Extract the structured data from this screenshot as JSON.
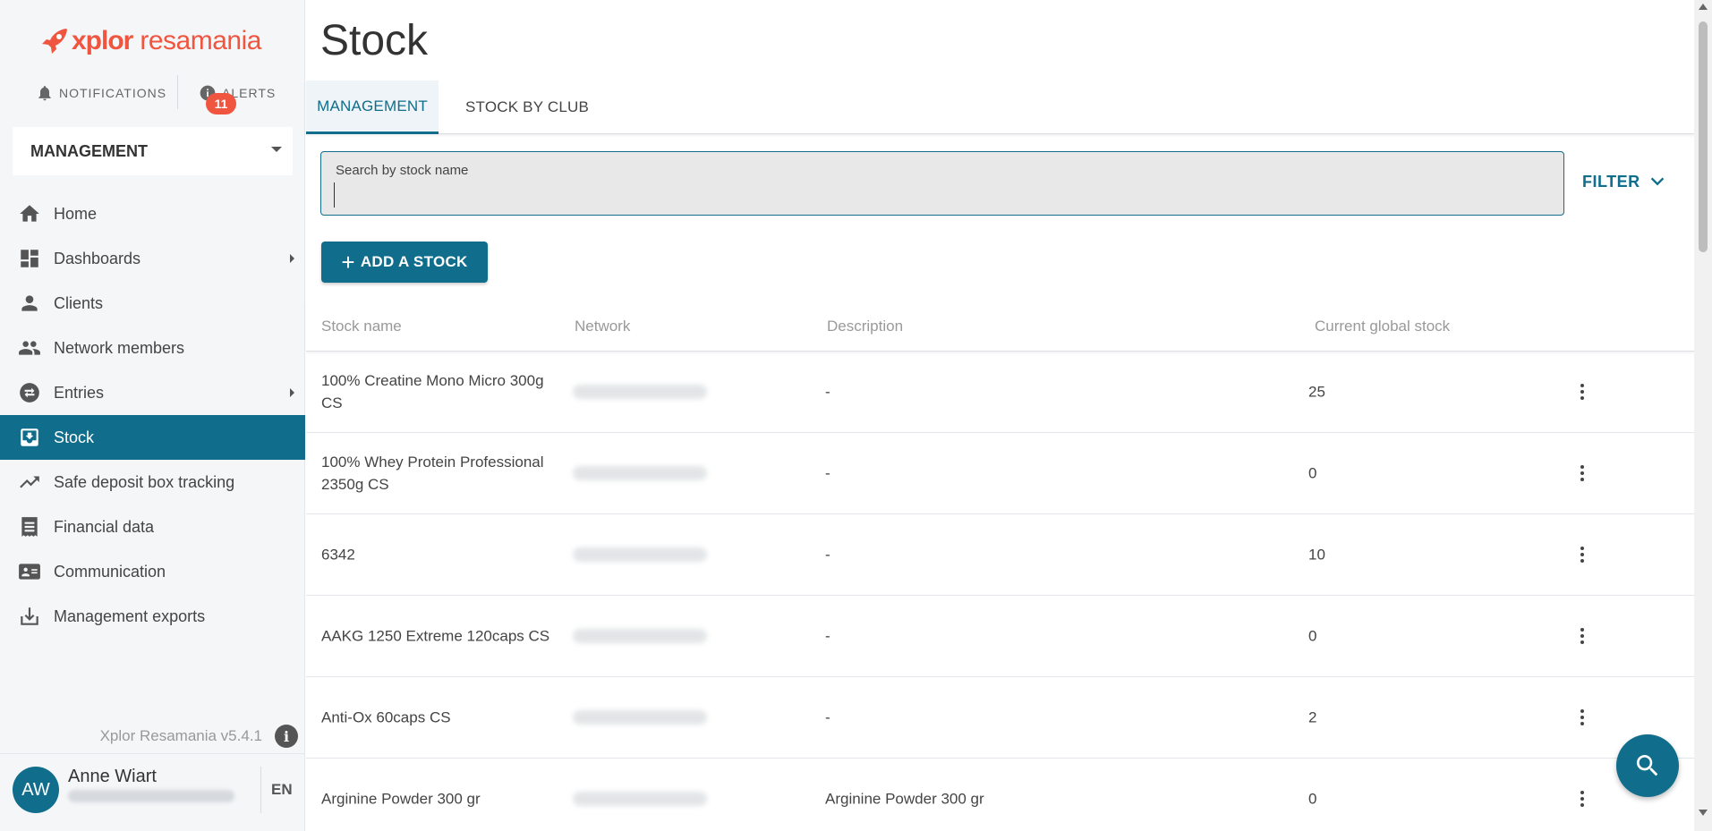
{
  "brand": {
    "name_part1": "xplor",
    "name_part2": "resamania",
    "color": "#f0553f"
  },
  "top_buttons": {
    "notifications": "NOTIFICATIONS",
    "alerts": "ALERTS",
    "alerts_count": "11"
  },
  "context_select": {
    "value": "MANAGEMENT"
  },
  "sidebar": {
    "items": [
      {
        "label": "Home",
        "icon": "home-icon"
      },
      {
        "label": "Dashboards",
        "icon": "dashboard-icon"
      },
      {
        "label": "Clients",
        "icon": "person-icon"
      },
      {
        "label": "Network members",
        "icon": "people-icon"
      },
      {
        "label": "Entries",
        "icon": "swap-icon"
      },
      {
        "label": "Stock",
        "icon": "stock-icon"
      },
      {
        "label": "Safe deposit box tracking",
        "icon": "trending-up-icon"
      },
      {
        "label": "Financial data",
        "icon": "receipt-icon"
      },
      {
        "label": "Communication",
        "icon": "contact-card-icon"
      },
      {
        "label": "Management exports",
        "icon": "download-icon"
      }
    ],
    "version": "Xplor Resamania v5.4.1"
  },
  "user": {
    "initials": "AW",
    "name": "Anne Wiart",
    "language": "EN"
  },
  "main": {
    "title": "Stock",
    "tabs": [
      {
        "label": "MANAGEMENT"
      },
      {
        "label": "STOCK BY CLUB"
      }
    ],
    "search": {
      "label": "Search by stock name",
      "value": ""
    },
    "filter_label": "FILTER",
    "add_button": "ADD A STOCK",
    "table": {
      "headers": [
        "Stock name",
        "Network",
        "Description",
        "Current global stock"
      ],
      "rows": [
        {
          "name": "100% Creatine Mono Micro 300g CS",
          "description": "-",
          "stock": "25"
        },
        {
          "name": "100% Whey Protein Professional 2350g CS",
          "description": "-",
          "stock": "0"
        },
        {
          "name": "6342",
          "description": "-",
          "stock": "10"
        },
        {
          "name": "AAKG 1250 Extreme 120caps CS",
          "description": "-",
          "stock": "0"
        },
        {
          "name": "Anti-Ox 60caps CS",
          "description": "-",
          "stock": "2"
        },
        {
          "name": "Arginine Powder 300 gr",
          "description": "Arginine Powder 300 gr",
          "stock": "0"
        }
      ]
    }
  },
  "colors": {
    "primary": "#106d8c",
    "accent": "#f0553f"
  }
}
